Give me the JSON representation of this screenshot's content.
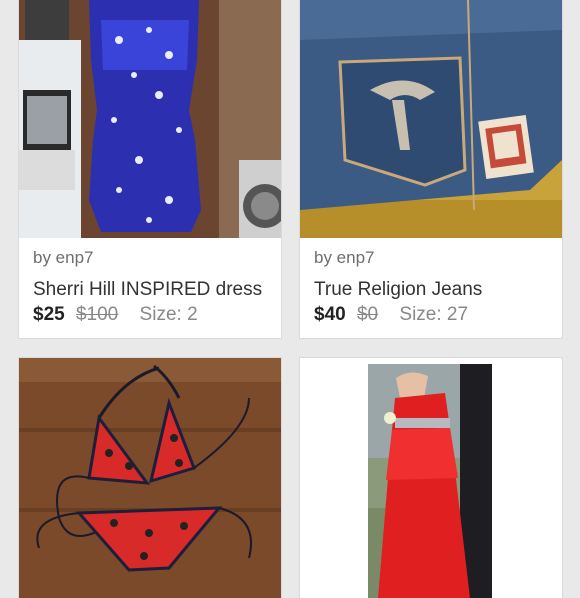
{
  "listings": [
    {
      "seller": "by enp7",
      "title": "Sherri Hill INSPIRED dress",
      "price": "$25",
      "original_price": "$100",
      "size": "Size: 2",
      "image": "blue-sequin-dress-photo"
    },
    {
      "seller": "by enp7",
      "title": "True Religion Jeans",
      "price": "$40",
      "original_price": "$0",
      "size": "Size: 27",
      "image": "jeans-back-pocket-photo"
    },
    {
      "image": "red-polka-dot-bikini-photo"
    },
    {
      "image": "red-strapless-gown-photo"
    }
  ]
}
